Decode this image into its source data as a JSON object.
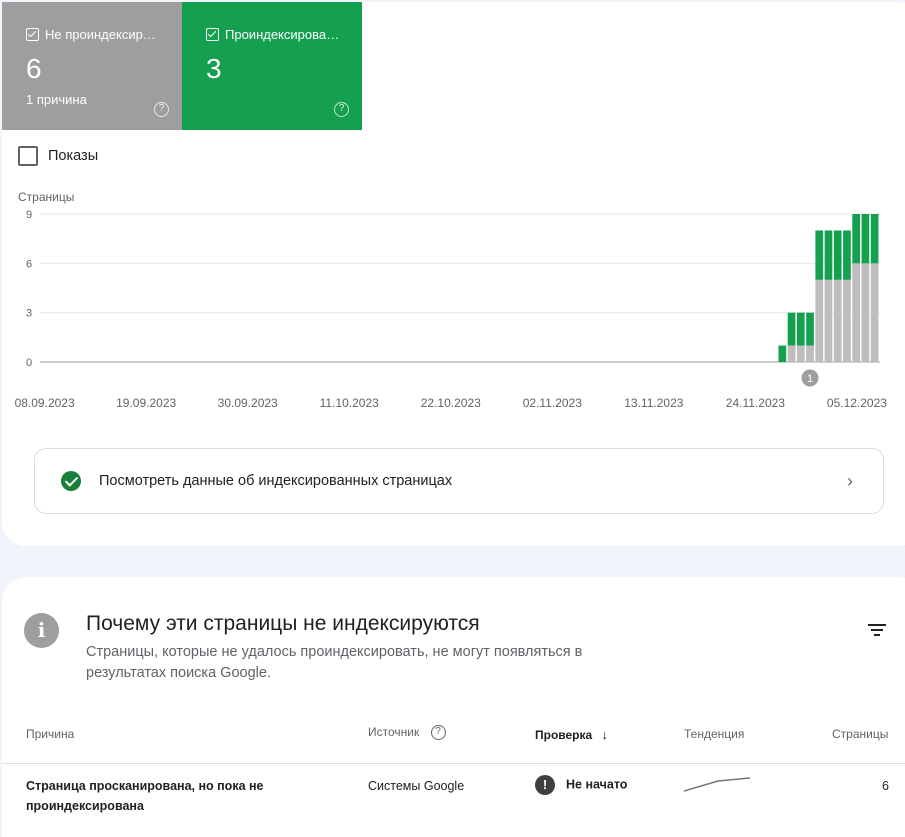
{
  "tiles": {
    "not_indexed": {
      "label": "Не проиндексир…",
      "count": "6",
      "sub": "1 причина",
      "help": "?"
    },
    "indexed": {
      "label": "Проиндексирова…",
      "count": "3",
      "help": "?"
    }
  },
  "impressions_checkbox": "Показы",
  "chart_data": {
    "type": "bar",
    "stacked": true,
    "ylabel": "Страницы",
    "ylim": [
      0,
      9
    ],
    "yticks": [
      "9",
      "6",
      "3",
      "0"
    ],
    "xticks": [
      "08.09.2023",
      "19.09.2023",
      "30.09.2023",
      "11.10.2023",
      "22.10.2023",
      "02.11.2023",
      "13.11.2023",
      "24.11.2023",
      "05.12.2023"
    ],
    "annotation": "1",
    "colors": {
      "not_indexed": "#bdbdbd",
      "indexed": "#15a050"
    },
    "dates": [
      "2023-11-27",
      "2023-11-28",
      "2023-11-29",
      "2023-11-30",
      "2023-12-01",
      "2023-12-02",
      "2023-12-03",
      "2023-12-04",
      "2023-12-05",
      "2023-12-06",
      "2023-12-07"
    ],
    "series": [
      {
        "name": "Не проиндексир…",
        "values": [
          0,
          1,
          1,
          1,
          5,
          5,
          5,
          5,
          6,
          6,
          6
        ]
      },
      {
        "name": "Проиндексирова…",
        "values": [
          1,
          2,
          2,
          2,
          3,
          3,
          3,
          3,
          3,
          3,
          3
        ]
      }
    ],
    "grid": true
  },
  "link_card": {
    "text": "Посмотреть данные об индексированных страницах",
    "chevron": "›"
  },
  "why": {
    "title": "Почему эти страницы не индексируются",
    "subtitle": "Страницы, которые не удалось проиндексировать, не могут появляться в результатах поиска Google."
  },
  "table": {
    "headers": {
      "reason": "Причина",
      "source": "Источник",
      "check": "Проверка",
      "trend": "Тенденция",
      "pages": "Страницы"
    },
    "sort_arrow": "↓",
    "rows": [
      {
        "reason": "Страница просканирована, но пока не проиндексирована",
        "source": "Системы Google",
        "status": "Не начато",
        "status_icon": "!",
        "pages": "6"
      }
    ]
  }
}
